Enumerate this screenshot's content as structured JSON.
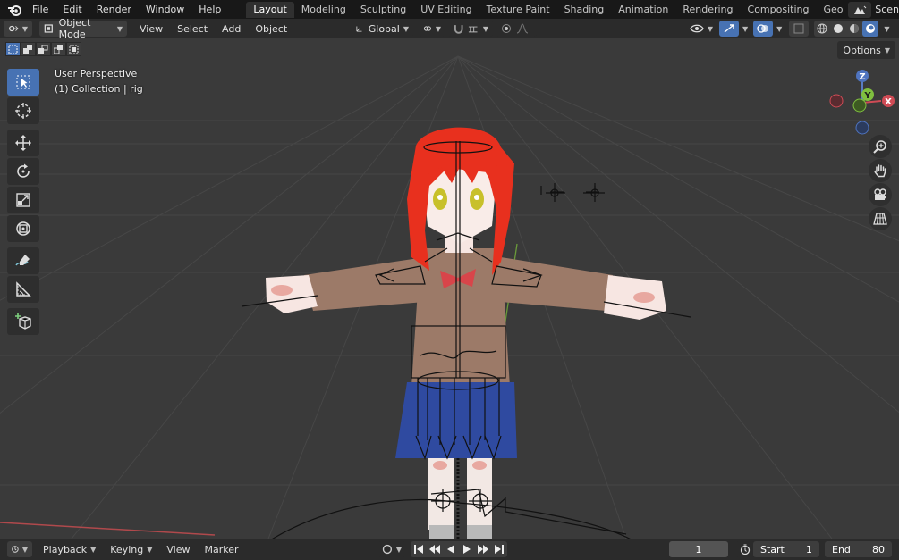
{
  "topbar": {
    "menus": [
      "File",
      "Edit",
      "Render",
      "Window",
      "Help"
    ],
    "workspace_tabs": [
      "Layout",
      "Modeling",
      "Sculpting",
      "UV Editing",
      "Texture Paint",
      "Shading",
      "Animation",
      "Rendering",
      "Compositing",
      "Geometry Node"
    ],
    "active_tab": "Layout",
    "scene_label": "Scen"
  },
  "header": {
    "mode": "Object Mode",
    "menus": [
      "View",
      "Select",
      "Add",
      "Object"
    ],
    "transform_orientation": "Global",
    "options_label": "Options"
  },
  "viewport": {
    "view_name": "User Perspective",
    "collection_info": "(1) Collection | rig",
    "gizmo_axes": [
      "Z",
      "Y",
      "X"
    ],
    "colors": {
      "background": "#3a3a3a",
      "grid": "#4a4a4a",
      "x_axis": "#c94b50",
      "y_axis": "#7fbf3f",
      "accent": "#4772b3"
    }
  },
  "toolbar": {
    "tools": [
      "select-box",
      "cursor",
      "move",
      "rotate",
      "scale",
      "transform",
      "annotate",
      "measure",
      "add-cube"
    ],
    "active_tool": "select-box"
  },
  "timeline": {
    "menus": [
      "Playback",
      "Keying",
      "View",
      "Marker"
    ],
    "current_frame": "1",
    "start_label": "Start",
    "start_value": "1",
    "end_label": "End",
    "end_value": "80"
  }
}
